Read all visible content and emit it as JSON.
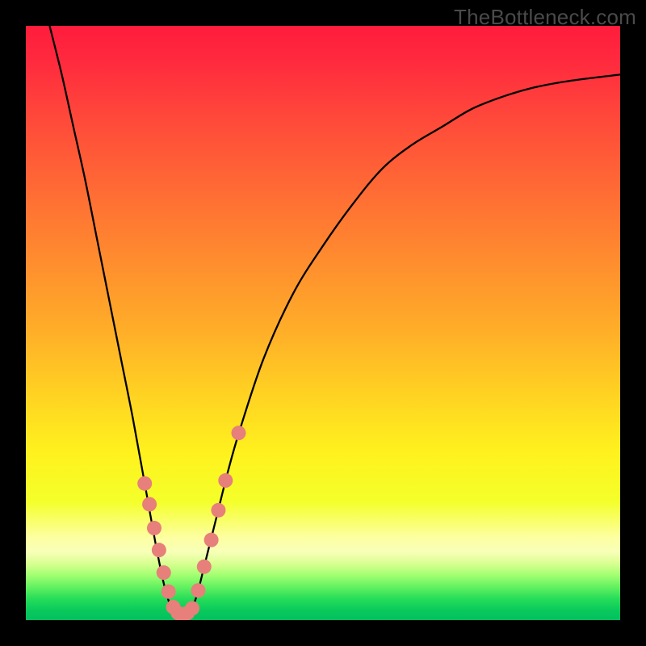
{
  "watermark": "TheBottleneck.com",
  "chart_data": {
    "type": "line",
    "title": "",
    "xlabel": "",
    "ylabel": "",
    "xlim": [
      0,
      1
    ],
    "ylim": [
      0,
      1
    ],
    "series": [
      {
        "name": "bottleneck-curve",
        "x": [
          0.04,
          0.06,
          0.08,
          0.1,
          0.12,
          0.14,
          0.16,
          0.18,
          0.2,
          0.22,
          0.235,
          0.25,
          0.26,
          0.27,
          0.28,
          0.29,
          0.3,
          0.32,
          0.34,
          0.36,
          0.4,
          0.45,
          0.5,
          0.55,
          0.6,
          0.65,
          0.7,
          0.75,
          0.8,
          0.85,
          0.9,
          0.95,
          1.0
        ],
        "y": [
          1.0,
          0.92,
          0.83,
          0.74,
          0.64,
          0.54,
          0.44,
          0.34,
          0.23,
          0.12,
          0.05,
          0.01,
          0.01,
          0.01,
          0.02,
          0.05,
          0.09,
          0.17,
          0.25,
          0.32,
          0.44,
          0.55,
          0.63,
          0.7,
          0.76,
          0.8,
          0.83,
          0.86,
          0.88,
          0.895,
          0.905,
          0.912,
          0.918
        ]
      }
    ],
    "markers": [
      {
        "x": 0.2,
        "y": 0.23
      },
      {
        "x": 0.208,
        "y": 0.195
      },
      {
        "x": 0.216,
        "y": 0.155
      },
      {
        "x": 0.224,
        "y": 0.118
      },
      {
        "x": 0.232,
        "y": 0.08
      },
      {
        "x": 0.24,
        "y": 0.048
      },
      {
        "x": 0.248,
        "y": 0.022
      },
      {
        "x": 0.256,
        "y": 0.012
      },
      {
        "x": 0.264,
        "y": 0.01
      },
      {
        "x": 0.272,
        "y": 0.012
      },
      {
        "x": 0.28,
        "y": 0.02
      },
      {
        "x": 0.29,
        "y": 0.05
      },
      {
        "x": 0.3,
        "y": 0.09
      },
      {
        "x": 0.312,
        "y": 0.135
      },
      {
        "x": 0.324,
        "y": 0.185
      },
      {
        "x": 0.336,
        "y": 0.235
      },
      {
        "x": 0.358,
        "y": 0.315
      }
    ],
    "gradient_stops": [
      {
        "pos": 0.0,
        "color": "#ff1c3c"
      },
      {
        "pos": 0.06,
        "color": "#ff2a3e"
      },
      {
        "pos": 0.16,
        "color": "#ff4a3a"
      },
      {
        "pos": 0.28,
        "color": "#ff6c34"
      },
      {
        "pos": 0.4,
        "color": "#ff8e2e"
      },
      {
        "pos": 0.52,
        "color": "#ffb028"
      },
      {
        "pos": 0.62,
        "color": "#ffd222"
      },
      {
        "pos": 0.72,
        "color": "#fff21e"
      },
      {
        "pos": 0.8,
        "color": "#f4ff2a"
      },
      {
        "pos": 0.86,
        "color": "#fdffa0"
      },
      {
        "pos": 0.885,
        "color": "#f8ffb8"
      },
      {
        "pos": 0.905,
        "color": "#d8ff90"
      },
      {
        "pos": 0.925,
        "color": "#a0ff70"
      },
      {
        "pos": 0.945,
        "color": "#60f060"
      },
      {
        "pos": 0.965,
        "color": "#24dc58"
      },
      {
        "pos": 0.985,
        "color": "#08c85c"
      },
      {
        "pos": 1.0,
        "color": "#04c060"
      }
    ],
    "marker_color": "#e77f7a",
    "curve_color": "#000000"
  }
}
